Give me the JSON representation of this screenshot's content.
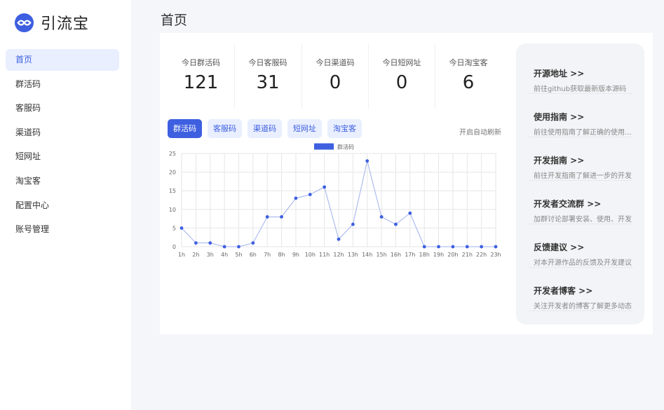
{
  "app": {
    "name": "引流宝",
    "accent": "#3d5fe0"
  },
  "sidebar": {
    "items": [
      {
        "label": "首页",
        "active": true
      },
      {
        "label": "群活码"
      },
      {
        "label": "客服码"
      },
      {
        "label": "渠道码"
      },
      {
        "label": "短网址"
      },
      {
        "label": "淘宝客"
      },
      {
        "label": "配置中心"
      },
      {
        "label": "账号管理"
      }
    ]
  },
  "main": {
    "title": "首页"
  },
  "stats": [
    {
      "label": "今日群活码",
      "value": "121"
    },
    {
      "label": "今日客服码",
      "value": "31"
    },
    {
      "label": "今日渠道码",
      "value": "0"
    },
    {
      "label": "今日短网址",
      "value": "0"
    },
    {
      "label": "今日淘宝客",
      "value": "6"
    }
  ],
  "tabs": [
    {
      "label": "群活码",
      "active": true
    },
    {
      "label": "客服码"
    },
    {
      "label": "渠道码"
    },
    {
      "label": "短网址"
    },
    {
      "label": "淘宝客"
    }
  ],
  "auto_refresh_label": "开启自动刷新",
  "chart_data": {
    "type": "line",
    "categories": [
      "1h",
      "2h",
      "3h",
      "4h",
      "5h",
      "6h",
      "7h",
      "8h",
      "9h",
      "10h",
      "11h",
      "12h",
      "13h",
      "14h",
      "15h",
      "16h",
      "17h",
      "18h",
      "19h",
      "20h",
      "21h",
      "22h",
      "23h"
    ],
    "series": [
      {
        "name": "群活码",
        "color": "#3d5fe0",
        "values": [
          5,
          1,
          1,
          0,
          0,
          1,
          8,
          8,
          13,
          14,
          16,
          2,
          6,
          23,
          8,
          6,
          9,
          0,
          0,
          0,
          0,
          0,
          0
        ]
      }
    ],
    "yticks": [
      0,
      5,
      10,
      15,
      20,
      25
    ],
    "ylim": [
      0,
      25
    ],
    "legend": "top-center",
    "grid": true
  },
  "links": [
    {
      "title": "开源地址 >>",
      "desc": "前往github获取最新版本源码"
    },
    {
      "title": "使用指南 >>",
      "desc": "前往使用指南了解正确的使用方法"
    },
    {
      "title": "开发指南 >>",
      "desc": "前往开发指南了解进一步的开发"
    },
    {
      "title": "开发者交流群 >>",
      "desc": "加群讨论部署安装、使用、开发"
    },
    {
      "title": "反馈建议 >>",
      "desc": "对本开源作品的反馈及开发建议"
    },
    {
      "title": "开发者博客 >>",
      "desc": "关注开发者的博客了解更多动态"
    }
  ]
}
